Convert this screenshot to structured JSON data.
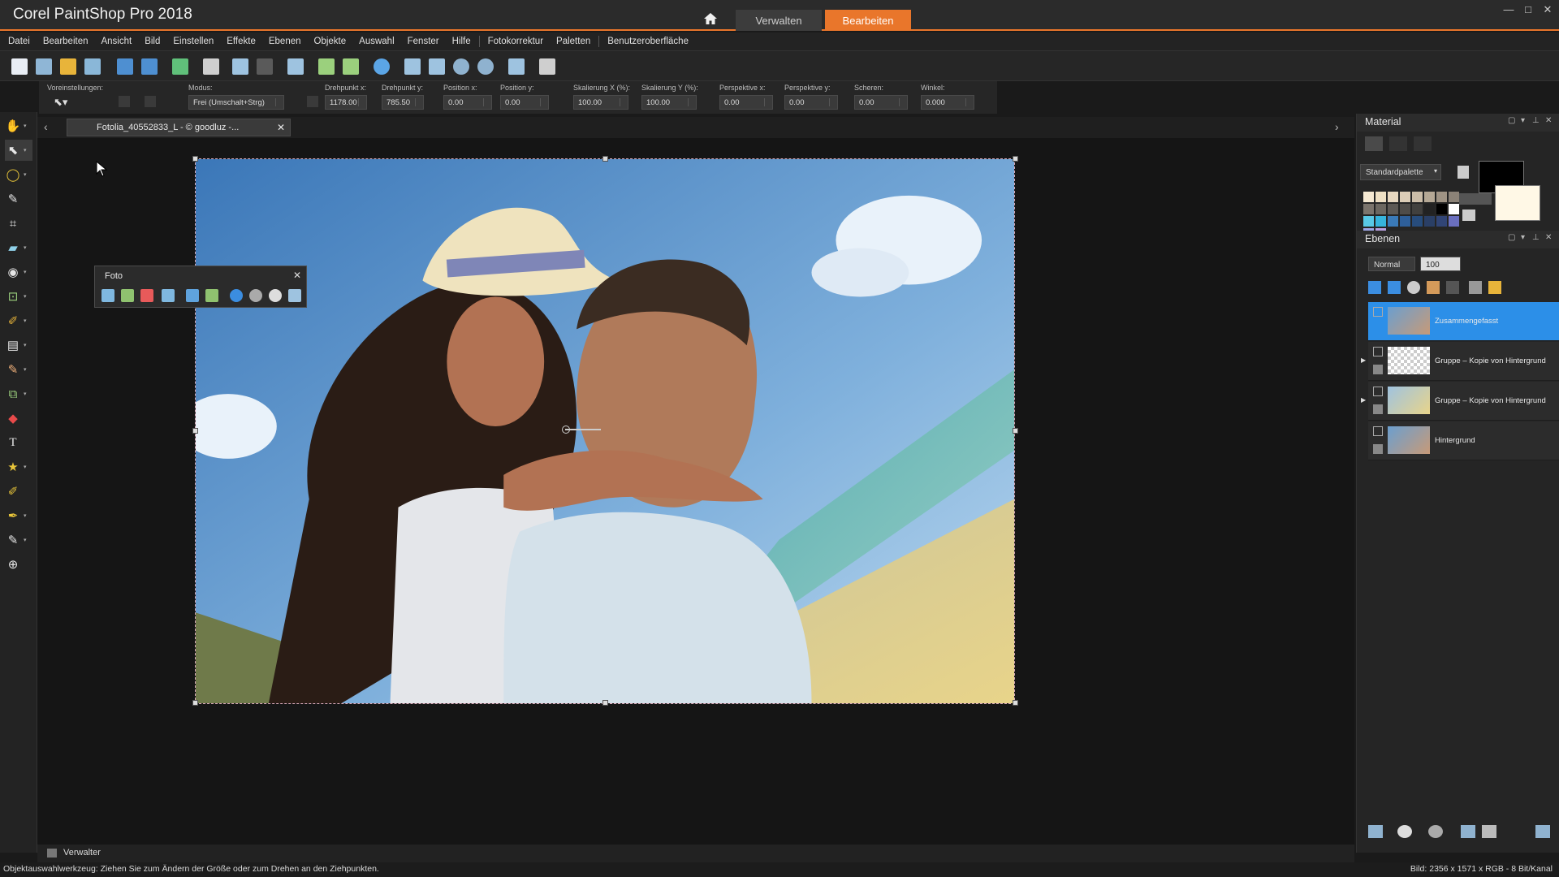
{
  "app": {
    "title": "Corel PaintShop Pro 2018",
    "tabs": {
      "manage": "Verwalten",
      "edit": "Bearbeiten"
    },
    "window_controls": [
      "—",
      "□",
      "✕"
    ]
  },
  "menu": [
    "Datei",
    "Bearbeiten",
    "Ansicht",
    "Bild",
    "Einstellen",
    "Effekte",
    "Ebenen",
    "Objekte",
    "Auswahl",
    "Fenster",
    "Hilfe",
    "Fotokorrektur",
    "Paletten",
    "Benutzeroberfläche"
  ],
  "options": {
    "presets_label": "Voreinstellungen:",
    "mode_label": "Modus:",
    "mode_value": "Frei (Umschalt+Strg)",
    "pivot_x_label": "Drehpunkt x:",
    "pivot_x": "1178.00",
    "pivot_y_label": "Drehpunkt y:",
    "pivot_y": "785.50",
    "pos_x_label": "Position x:",
    "pos_x": "0.00",
    "pos_y_label": "Position y:",
    "pos_y": "0.00",
    "scale_x_label": "Skalierung X (%):",
    "scale_x": "100.00",
    "scale_y_label": "Skalierung Y (%):",
    "scale_y": "100.00",
    "persp_x_label": "Perspektive x:",
    "persp_x": "0.00",
    "persp_y_label": "Perspektive y:",
    "persp_y": "0.00",
    "shear_label": "Scheren:",
    "shear": "0.00",
    "angle_label": "Winkel:",
    "angle": "0.000"
  },
  "document": {
    "tab_title": "Fotolia_40552833_L - © goodluz -...",
    "close": "✕",
    "nav_left": "‹",
    "nav_right": "›"
  },
  "foto_palette": {
    "title": "Foto",
    "close": "✕",
    "icons": [
      "rotate-icon",
      "image-icon",
      "red-eye-icon",
      "straighten-icon",
      "fade-icon",
      "color-balance-icon",
      "one-step-fix-icon",
      "smart-fix-icon",
      "clarify-icon",
      "crop-icon"
    ]
  },
  "material_panel": {
    "title": "Material",
    "palette_select": "Standardpalette",
    "swatch_colors": [
      "#f6e9d2",
      "#efe0c4",
      "#e8d8c0",
      "#dccdb7",
      "#cbbda8",
      "#b5a895",
      "#9f9384",
      "#8b8277",
      "#7b746c",
      "#6c6760",
      "#5d5955",
      "#4f4c49",
      "#41403e",
      "#222222",
      "#000000",
      "#ffffff",
      "#58c9e6",
      "#36b4dc",
      "#3a7ab8",
      "#2e5f9a",
      "#274c7c",
      "#2a3f66",
      "#314576",
      "#6a6fbf",
      "#9ea6e5",
      "#b9a0e0"
    ],
    "foreground": "#000000",
    "background": "#fff8e6"
  },
  "layers_panel": {
    "title": "Ebenen",
    "blend_mode": "Normal",
    "opacity": "100",
    "layers": [
      {
        "name": "Zusammengefasst",
        "active": true
      },
      {
        "name": "Gruppe – Kopie von Hintergrund",
        "active": false
      },
      {
        "name": "Gruppe – Kopie von Hintergrund",
        "active": false
      },
      {
        "name": "Hintergrund",
        "active": false
      }
    ]
  },
  "bottom": {
    "organizer_tab": "Verwalter",
    "status_left": "Objektauswahlwerkzeug: Ziehen Sie zum Ändern der Größe oder zum Drehen an den Ziehpunkten.",
    "status_right": "Bild: 2356 x 1571 x RGB - 8 Bit/Kanal"
  },
  "colors": {
    "accent": "#e9762b",
    "selection": "#2c8fe8"
  }
}
